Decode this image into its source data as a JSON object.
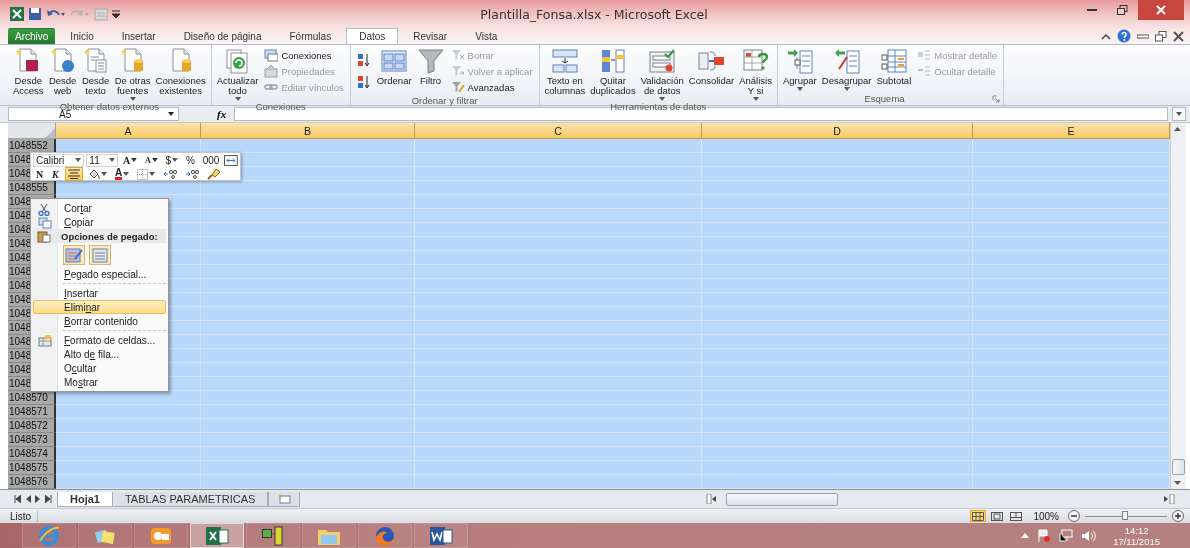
{
  "window": {
    "title": "Plantilla_Fonsa.xlsx - Microsoft Excel"
  },
  "ribbon_tabs": [
    {
      "label": "Archivo",
      "kind": "file",
      "selected": false
    },
    {
      "label": "Inicio",
      "kind": "tab",
      "selected": false
    },
    {
      "label": "Insertar",
      "kind": "tab",
      "selected": false
    },
    {
      "label": "Diseño de página",
      "kind": "tab",
      "selected": false
    },
    {
      "label": "Fórmulas",
      "kind": "tab",
      "selected": false
    },
    {
      "label": "Datos",
      "kind": "tab",
      "selected": true
    },
    {
      "label": "Revisar",
      "kind": "tab",
      "selected": false
    },
    {
      "label": "Vista",
      "kind": "tab",
      "selected": false
    }
  ],
  "ribbon_groups": [
    {
      "title": "Obtener datos externos",
      "launcher": false,
      "items": [
        {
          "kind": "large",
          "label": "Desde\nAccess",
          "dropdown": false
        },
        {
          "kind": "large",
          "label": "Desde\nweb",
          "dropdown": false
        },
        {
          "kind": "large",
          "label": "Desde\ntexto",
          "dropdown": false
        },
        {
          "kind": "large",
          "label": "De otras\nfuentes",
          "dropdown": true
        },
        {
          "kind": "large",
          "label": "Conexiones\nexistentes",
          "dropdown": false
        }
      ]
    },
    {
      "title": "Conexiones",
      "launcher": false,
      "items": [
        {
          "kind": "large",
          "label": "Actualizar\ntodo",
          "dropdown": true
        },
        {
          "kind": "stack",
          "items": [
            {
              "label": "Conexiones",
              "disabled": false
            },
            {
              "label": "Propiedades",
              "disabled": true
            },
            {
              "label": "Editar vínculos",
              "disabled": true
            }
          ]
        }
      ]
    },
    {
      "title": "Ordenar y filtrar",
      "launcher": false,
      "items": [
        {
          "kind": "sort-pair"
        },
        {
          "kind": "large",
          "label": "Ordenar",
          "dropdown": false
        },
        {
          "kind": "large",
          "label": "Filtro",
          "dropdown": false
        },
        {
          "kind": "stack",
          "items": [
            {
              "label": "Borrar",
              "disabled": true
            },
            {
              "label": "Volver a aplicar",
              "disabled": true
            },
            {
              "label": "Avanzadas",
              "disabled": false
            }
          ]
        }
      ]
    },
    {
      "title": "Herramientas de datos",
      "launcher": false,
      "items": [
        {
          "kind": "large",
          "label": "Texto en\ncolumnas",
          "dropdown": false
        },
        {
          "kind": "large",
          "label": "Quitar\nduplicados",
          "dropdown": false
        },
        {
          "kind": "large",
          "label": "Validación\nde datos",
          "dropdown": true
        },
        {
          "kind": "large",
          "label": "Consolidar",
          "dropdown": false
        },
        {
          "kind": "large",
          "label": "Análisis\nY si",
          "dropdown": true
        }
      ]
    },
    {
      "title": "Esquema",
      "launcher": true,
      "items": [
        {
          "kind": "large",
          "label": "Agrupar",
          "dropdown": true
        },
        {
          "kind": "large",
          "label": "Desagrupar",
          "dropdown": true
        },
        {
          "kind": "large",
          "label": "Subtotal",
          "dropdown": false
        },
        {
          "kind": "stack",
          "items": [
            {
              "label": "Mostrar detalle",
              "disabled": true
            },
            {
              "label": "Ocultar detalle",
              "disabled": true
            }
          ]
        }
      ]
    }
  ],
  "formula_bar": {
    "name_box": "A5",
    "function_label": "fx"
  },
  "columns": [
    {
      "label": "A",
      "selected": true
    },
    {
      "label": "B",
      "selected": true
    },
    {
      "label": "C",
      "selected": true
    },
    {
      "label": "D",
      "selected": true
    },
    {
      "label": "E",
      "selected": true
    }
  ],
  "rows": [
    {
      "label": "1048552",
      "selected": true
    },
    {
      "label": "1048",
      "selected": true
    },
    {
      "label": "1048",
      "selected": true
    },
    {
      "label": "1048555",
      "selected": true
    },
    {
      "label": "1048",
      "selected": true
    },
    {
      "label": "1048",
      "selected": true
    },
    {
      "label": "1048",
      "selected": true
    },
    {
      "label": "1048",
      "selected": true
    },
    {
      "label": "1048",
      "selected": true
    },
    {
      "label": "1048",
      "selected": true
    },
    {
      "label": "1048",
      "selected": true
    },
    {
      "label": "1048",
      "selected": true
    },
    {
      "label": "1048",
      "selected": true
    },
    {
      "label": "1048",
      "selected": true
    },
    {
      "label": "1048",
      "selected": true
    },
    {
      "label": "1048",
      "selected": true
    },
    {
      "label": "1048",
      "selected": true
    },
    {
      "label": "1048",
      "selected": true
    },
    {
      "label": "1048570",
      "selected": true
    },
    {
      "label": "1048571",
      "selected": true
    },
    {
      "label": "1048572",
      "selected": true
    },
    {
      "label": "1048573",
      "selected": true
    },
    {
      "label": "1048574",
      "selected": true
    },
    {
      "label": "1048575",
      "selected": true
    },
    {
      "label": "1048576",
      "selected": true
    }
  ],
  "mini_toolbar": {
    "font": "Calibri",
    "size": "11",
    "row1": [
      {
        "kind": "grow",
        "text": "A"
      },
      {
        "kind": "shrink",
        "text": "A"
      },
      {
        "kind": "menu",
        "text": "$"
      },
      {
        "kind": "plain",
        "text": "%"
      },
      {
        "kind": "plain",
        "text": "000"
      },
      {
        "kind": "merge"
      }
    ],
    "row2": [
      {
        "kind": "bold",
        "text": "N",
        "selected": false
      },
      {
        "kind": "italic",
        "text": "K",
        "selected": false
      },
      {
        "kind": "align",
        "selected": true
      },
      {
        "kind": "fill",
        "selected": false
      },
      {
        "kind": "font-color",
        "text": "A",
        "selected": false
      },
      {
        "kind": "borders",
        "selected": false
      },
      {
        "kind": "increase-decimal",
        "selected": false
      },
      {
        "kind": "decrease-decimal",
        "selected": false
      },
      {
        "kind": "painter",
        "selected": false
      }
    ]
  },
  "context_menu": {
    "items": [
      {
        "kind": "item",
        "icon": true,
        "label": {
          "pre": "Cor",
          "key": "t",
          "post": "ar"
        },
        "selected": false
      },
      {
        "kind": "item",
        "icon": true,
        "label": {
          "key": "C",
          "post": "opiar"
        },
        "selected": false
      },
      {
        "kind": "heading",
        "icon": true,
        "label": {
          "pre": "Opciones de pegado:"
        }
      },
      {
        "kind": "paste-options"
      },
      {
        "kind": "item",
        "icon": false,
        "label": {
          "key": "P",
          "post": "egado especial..."
        },
        "selected": false
      },
      {
        "kind": "separator"
      },
      {
        "kind": "item",
        "icon": false,
        "label": {
          "key": "I",
          "post": "nsertar"
        },
        "selected": false
      },
      {
        "kind": "item",
        "icon": false,
        "label": {
          "pre": "Elimi",
          "key": "n",
          "post": "ar"
        },
        "selected": true
      },
      {
        "kind": "item",
        "icon": false,
        "label": {
          "key": "B",
          "post": "orrar contenido"
        },
        "selected": false
      },
      {
        "kind": "separator"
      },
      {
        "kind": "item",
        "icon": true,
        "label": {
          "key": "F",
          "post": "ormato de celdas..."
        },
        "selected": false
      },
      {
        "kind": "item",
        "icon": false,
        "label": {
          "pre": "Alto d",
          "key": "e",
          "post": " fila..."
        },
        "selected": false
      },
      {
        "kind": "item",
        "icon": false,
        "label": {
          "pre": "O",
          "key": "c",
          "post": "ultar"
        },
        "selected": false
      },
      {
        "kind": "item",
        "icon": false,
        "label": {
          "pre": "Mo",
          "key": "s",
          "post": "trar"
        },
        "selected": false
      }
    ]
  },
  "sheet_tabs": [
    {
      "label": "Hoja1",
      "selected": true
    },
    {
      "label": "TABLAS PARAMETRICAS",
      "selected": false
    }
  ],
  "status_bar": {
    "text": "Listo",
    "views": [
      {
        "kind": "normal",
        "selected": true
      },
      {
        "kind": "page-layout",
        "selected": false
      },
      {
        "kind": "page-break",
        "selected": false
      }
    ],
    "zoom": "100%",
    "zoom_slider": {
      "level": 0.5
    }
  },
  "taskbar": {
    "apps": [
      {
        "selected": false
      },
      {
        "selected": false
      },
      {
        "selected": false
      },
      {
        "selected": true
      },
      {
        "selected": false
      },
      {
        "selected": false
      },
      {
        "selected": false
      },
      {
        "selected": false
      }
    ],
    "time": "14:12",
    "date": "17/11/2015"
  }
}
